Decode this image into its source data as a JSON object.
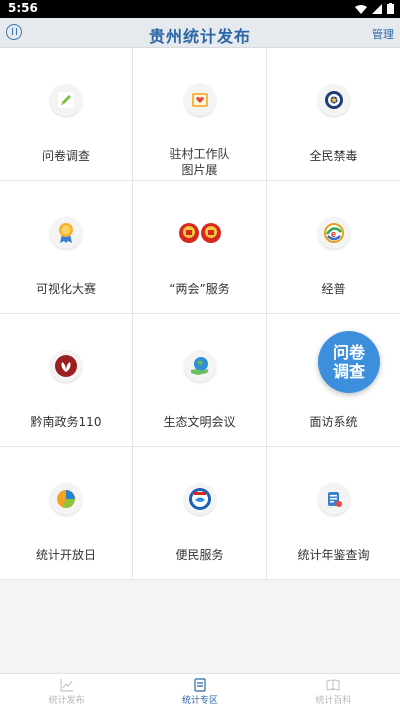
{
  "status": {
    "time": "5:56"
  },
  "header": {
    "title": "贵州统计发布",
    "right_label": "管理"
  },
  "tiles": [
    {
      "label": "问卷调查"
    },
    {
      "label_line1": "驻村工作队",
      "label_line2": "图片展"
    },
    {
      "label": "全民禁毒"
    },
    {
      "label": "可视化大赛"
    },
    {
      "label": "“两会”服务"
    },
    {
      "label": "经普"
    },
    {
      "label": "黔南政务110"
    },
    {
      "label": "生态文明会议"
    },
    {
      "label": "面访系统"
    },
    {
      "label": "统计开放日"
    },
    {
      "label": "便民服务"
    },
    {
      "label": "统计年鉴查询"
    }
  ],
  "float_button": {
    "line1": "问卷",
    "line2": "调查"
  },
  "bottom_nav": {
    "items": [
      {
        "label": "统计发布"
      },
      {
        "label": "统计专区"
      },
      {
        "label": "统计百科"
      }
    ]
  }
}
